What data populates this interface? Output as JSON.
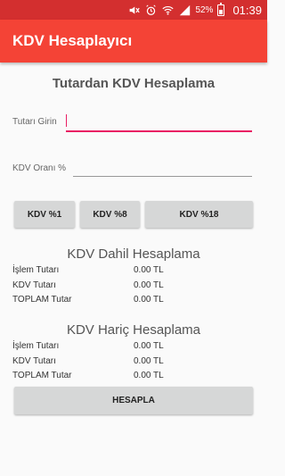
{
  "status_bar": {
    "battery": "52%",
    "time": "01:39",
    "icons": [
      "mute-icon",
      "alarm-icon",
      "wifi-icon",
      "signal-icon",
      "battery-icon"
    ]
  },
  "app_bar": {
    "title": "KDV Hesaplayıcı"
  },
  "main": {
    "heading": "Tutardan KDV Hesaplama",
    "amount_label": "Tutarı Girin",
    "amount_value": "",
    "rate_label": "KDV Oranı %",
    "rate_value": "",
    "buttons": {
      "kdv1": "KDV %1",
      "kdv8": "KDV %8",
      "kdv18": "KDV %18",
      "calculate": "HESAPLA"
    }
  },
  "dahil": {
    "title": "KDV Dahil Hesaplama",
    "rows": [
      {
        "label": "İşlem Tutarı",
        "value": "0.00 TL"
      },
      {
        "label": "KDV Tutarı",
        "value": "0.00 TL"
      },
      {
        "label": "TOPLAM Tutar",
        "value": "0.00 TL"
      }
    ]
  },
  "haric": {
    "title": "KDV Hariç Hesaplama",
    "rows": [
      {
        "label": "İşlem Tutarı",
        "value": "0.00 TL"
      },
      {
        "label": "KDV Tutarı",
        "value": "0.00 TL"
      },
      {
        "label": "TOPLAM Tutar",
        "value": "0.00 TL"
      }
    ]
  },
  "colors": {
    "status_bar": "#d32f2f",
    "app_bar": "#f44336",
    "accent": "#e91e63",
    "button": "#d6d7d7"
  }
}
